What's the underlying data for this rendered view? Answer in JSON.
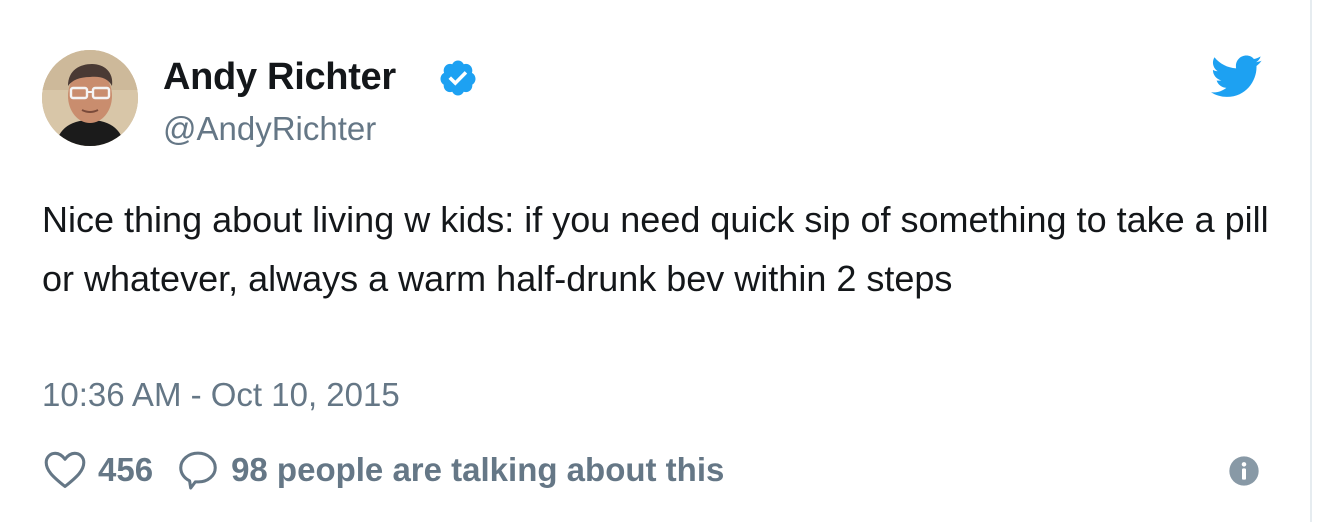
{
  "tweet": {
    "author_name": "Andy Richter",
    "handle": "@AndyRichter",
    "verified": true,
    "text": "Nice thing about living w kids: if you need quick sip of something to take a pill or whatever, always a warm half-drunk bev within 2 steps",
    "timestamp": "10:36 AM - Oct 10, 2015",
    "like_count": "456",
    "talk_text": "98 people are talking about this"
  },
  "icons": {
    "verified": "verified-badge-icon",
    "brand": "twitter-bird-icon",
    "like": "heart-icon",
    "reply": "speech-bubble-icon",
    "info": "info-icon"
  },
  "colors": {
    "brand_blue": "#1da1f2",
    "secondary_text": "#657786",
    "primary_text": "#14171a",
    "border": "#e6ecf0"
  }
}
